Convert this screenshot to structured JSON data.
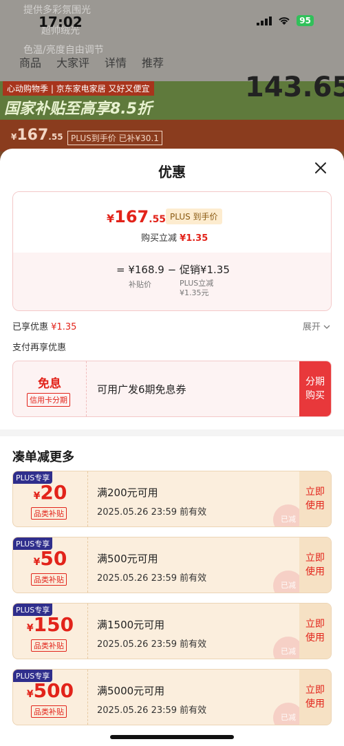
{
  "status_bar": {
    "time": "17:02",
    "battery": "95"
  },
  "background": {
    "text_lines": [
      "提供多彩氛围光",
      "超帅绒光",
      "色温/亮度自由调节"
    ],
    "tabs": [
      "商品",
      "大家评",
      "详情",
      "推荐"
    ],
    "promo_tag": "心动购物季 | 京东家电家居 又好又便宜",
    "promo_title": "国家补贴至高享8.5折",
    "big_price": "143.65",
    "price_cur": "¥",
    "price_main": "167",
    "price_dec": ".55",
    "plus_label": "PLUS到手价 已补¥30.1"
  },
  "sheet": {
    "title": "优惠",
    "price_card": {
      "currency": "¥",
      "price_main": "167",
      "price_dec": ".55",
      "plus_badge": "PLUS 到手价",
      "reduce_label": "购买立减",
      "reduce_value": "¥1.35",
      "formula": "= ¥168.9 − 促销¥1.35",
      "formula_sub1": "补贴价",
      "formula_sub2_line1": "PLUS立减",
      "formula_sub2_line2": "¥1.35元"
    },
    "enjoyed_label": "已享优惠",
    "enjoyed_value": "¥1.35",
    "expand_label": "展开",
    "pay_title": "支付再享优惠",
    "pay_coupon": {
      "title": "免息",
      "subtitle": "信用卡分期",
      "desc": "可用广发6期免息券",
      "button_line1": "分期",
      "button_line2": "购买"
    },
    "more_title": "凑单减更多",
    "tickets": [
      {
        "plus": "PLUS专享",
        "currency": "¥",
        "amount": "20",
        "category": "品类补贴",
        "condition": "满200元可用",
        "valid": "2025.05.26 23:59 前有效",
        "stamp": "已减",
        "btn1": "立即",
        "btn2": "使用"
      },
      {
        "plus": "PLUS专享",
        "currency": "¥",
        "amount": "50",
        "category": "品类补贴",
        "condition": "满500元可用",
        "valid": "2025.05.26 23:59 前有效",
        "stamp": "已减",
        "btn1": "立即",
        "btn2": "使用"
      },
      {
        "plus": "PLUS专享",
        "currency": "¥",
        "amount": "150",
        "category": "品类补贴",
        "condition": "满1500元可用",
        "valid": "2025.05.26 23:59 前有效",
        "stamp": "已减",
        "btn1": "立即",
        "btn2": "使用"
      },
      {
        "plus": "PLUS专享",
        "currency": "¥",
        "amount": "500",
        "category": "品类补贴",
        "condition": "满5000元可用",
        "valid": "2025.05.26 23:59 前有效",
        "stamp": "已减",
        "btn1": "立即",
        "btn2": "使用"
      }
    ]
  }
}
